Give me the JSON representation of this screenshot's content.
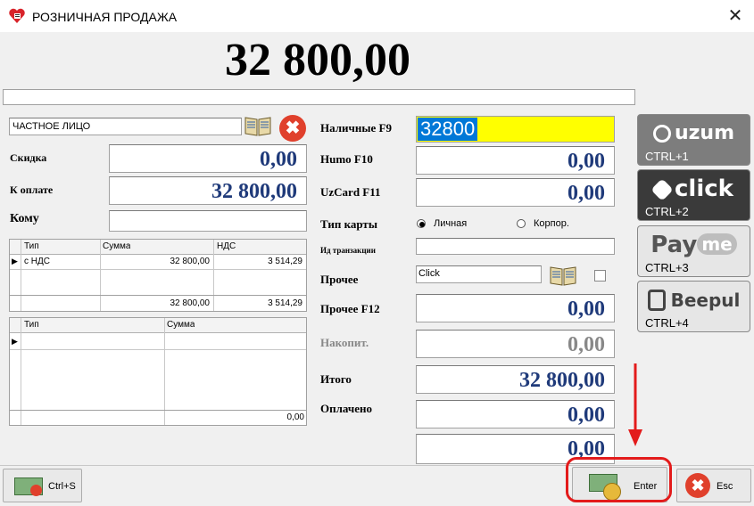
{
  "window": {
    "title": "РОЗНИЧНАЯ ПРОДАЖА",
    "close_glyph": "✕"
  },
  "total_display": "32 800,00",
  "customer": {
    "value": "ЧАСТНОЕ ЛИЦО"
  },
  "left": {
    "discount_label": "Скидка",
    "discount_value": "0,00",
    "to_pay_label": "К оплате",
    "to_pay_value": "32 800,00",
    "to_whom_label": "Кому",
    "to_whom_value": ""
  },
  "tax_table": {
    "columns": [
      "Тип",
      "Сумма",
      "НДС"
    ],
    "rows": [
      {
        "type": "с НДС",
        "sum": "32 800,00",
        "vat": "3 514,29"
      }
    ],
    "footer": {
      "sum": "32 800,00",
      "vat": "3 514,29"
    }
  },
  "pay_table": {
    "columns": [
      "Тип",
      "Сумма"
    ],
    "footer": {
      "sum": "0,00"
    }
  },
  "right": {
    "cash_label": "Наличные F9",
    "cash_value": "32800",
    "humo_label": "Humo F10",
    "humo_value": "0,00",
    "uzcard_label": "UzCard F11",
    "uzcard_value": "0,00",
    "card_type_label": "Тип карты",
    "card_type_personal": "Личная",
    "card_type_corporate": "Корпор.",
    "transaction_label": "Ид транзакции",
    "transaction_value": "",
    "other_label": "Прочее",
    "other_value": "Click",
    "other_f12_label": "Прочее F12",
    "other_f12_value": "0,00",
    "accumulated_label": "Накопит.",
    "accumulated_value": "0,00",
    "total_label": "Итого",
    "total_value": "32 800,00",
    "paid_label": "Оплачено",
    "paid_value": "0,00",
    "change_value": "0,00"
  },
  "pay_buttons": [
    {
      "brand": "uzum",
      "key": "CTRL+1"
    },
    {
      "brand": "click",
      "key": "CTRL+2"
    },
    {
      "brand_a": "Pay",
      "brand_b": "me",
      "key": "CTRL+3"
    },
    {
      "brand": "Beepul",
      "key": "CTRL+4"
    }
  ],
  "bottom": {
    "ctrls_label": "Ctrl+S",
    "enter_label": "Enter",
    "esc_label": "Esc"
  },
  "colors": {
    "cash_highlight": "#ffff00",
    "value_blue": "#1f3a7a",
    "annotation_red": "#e31b1b"
  }
}
